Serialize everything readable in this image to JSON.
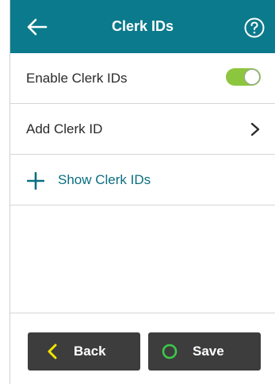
{
  "header": {
    "title": "Clerk IDs",
    "back_icon": "arrow-left-icon",
    "help_icon": "question-circle-icon"
  },
  "settings": {
    "enable_label": "Enable Clerk IDs",
    "enable_on": true,
    "add_label": "Add Clerk ID",
    "show_label": "Show Clerk IDs"
  },
  "footer": {
    "back_label": "Back",
    "save_label": "Save"
  },
  "colors": {
    "header": "#0b7a8c",
    "toggle_on": "#8cc63f",
    "back_accent": "#f2e600",
    "save_accent": "#3cc84a",
    "button_bg": "#3d3d3d"
  }
}
